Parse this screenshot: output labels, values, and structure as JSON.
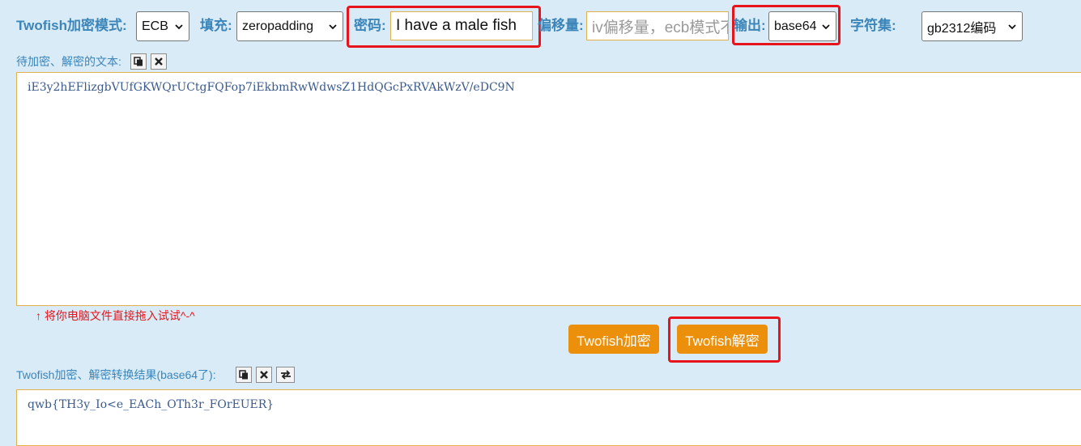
{
  "toolbar": {
    "mode_label": "Twofish加密模式:",
    "mode_value": "ECB",
    "padding_label": "填充:",
    "padding_value": "zeropadding",
    "key_label": "密码:",
    "key_value": "I have a male fish",
    "iv_label": "偏移量:",
    "iv_placeholder": "iv偏移量，ecb模式不用填写",
    "output_label": "输出:",
    "output_value": "base64",
    "charset_label": "字符集:",
    "charset_value": "gb2312编码"
  },
  "input_section": {
    "label": "待加密、解密的文本:",
    "text": "iE3y2hEFlizgbVUfGKWQrUCtgFQFop7iEkbmRwWdwsZ1HdQGcPxRVAkWzV/eDC9N",
    "hint": "↑ 将你电脑文件直接拖入试试^-^"
  },
  "actions": {
    "encrypt_label": "Twofish加密",
    "decrypt_label": "Twofish解密"
  },
  "result_section": {
    "label": "Twofish加密、解密转换结果(base64了):",
    "text": "qwb{TH3y_Io<e_EACh_OTh3r_FOrEUER}"
  },
  "colors": {
    "accent": "#ec900c",
    "label": "#3b85b9",
    "highlight": "#e8141c",
    "background": "#d9ebf6"
  }
}
